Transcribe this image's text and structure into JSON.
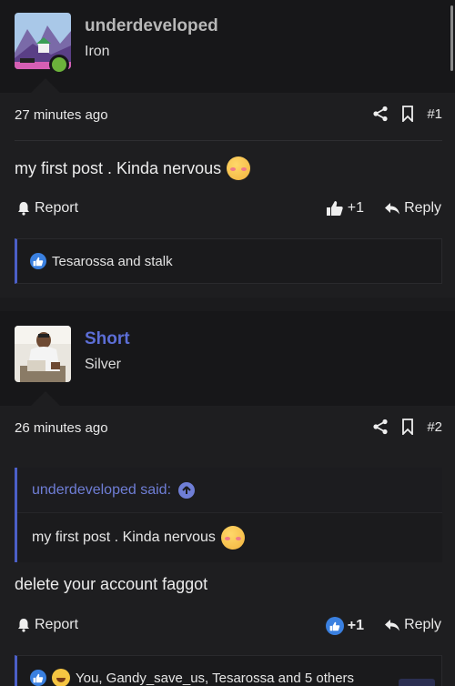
{
  "posts": [
    {
      "username": "underdeveloped",
      "rank": "Iron",
      "time": "27 minutes ago",
      "post_number": "#1",
      "text": "my first post . Kinda nervous",
      "actions": {
        "report": "Report",
        "like": "+1",
        "reply": "Reply"
      },
      "reactions": "Tesarossa and stalk"
    },
    {
      "username": "Short",
      "rank": "Silver",
      "time": "26 minutes ago",
      "post_number": "#2",
      "quote": {
        "author": "underdeveloped said:",
        "text": "my first post . Kinda nervous"
      },
      "text": "delete your account faggot",
      "actions": {
        "report": "Report",
        "like": "+1",
        "reply": "Reply"
      },
      "reactions": "You, Gandy_save_us, Tesarossa and 5 others"
    }
  ],
  "colors": {
    "accent": "#4b5fc7",
    "username1": "#b8b8b8",
    "username2": "#5c6ed6",
    "online": "#6cb23b"
  },
  "icons": [
    "share-icon",
    "bookmark-icon",
    "bell-icon",
    "thumbs-up-icon",
    "reply-icon",
    "arrow-up-icon",
    "like-icon",
    "laugh-icon"
  ]
}
